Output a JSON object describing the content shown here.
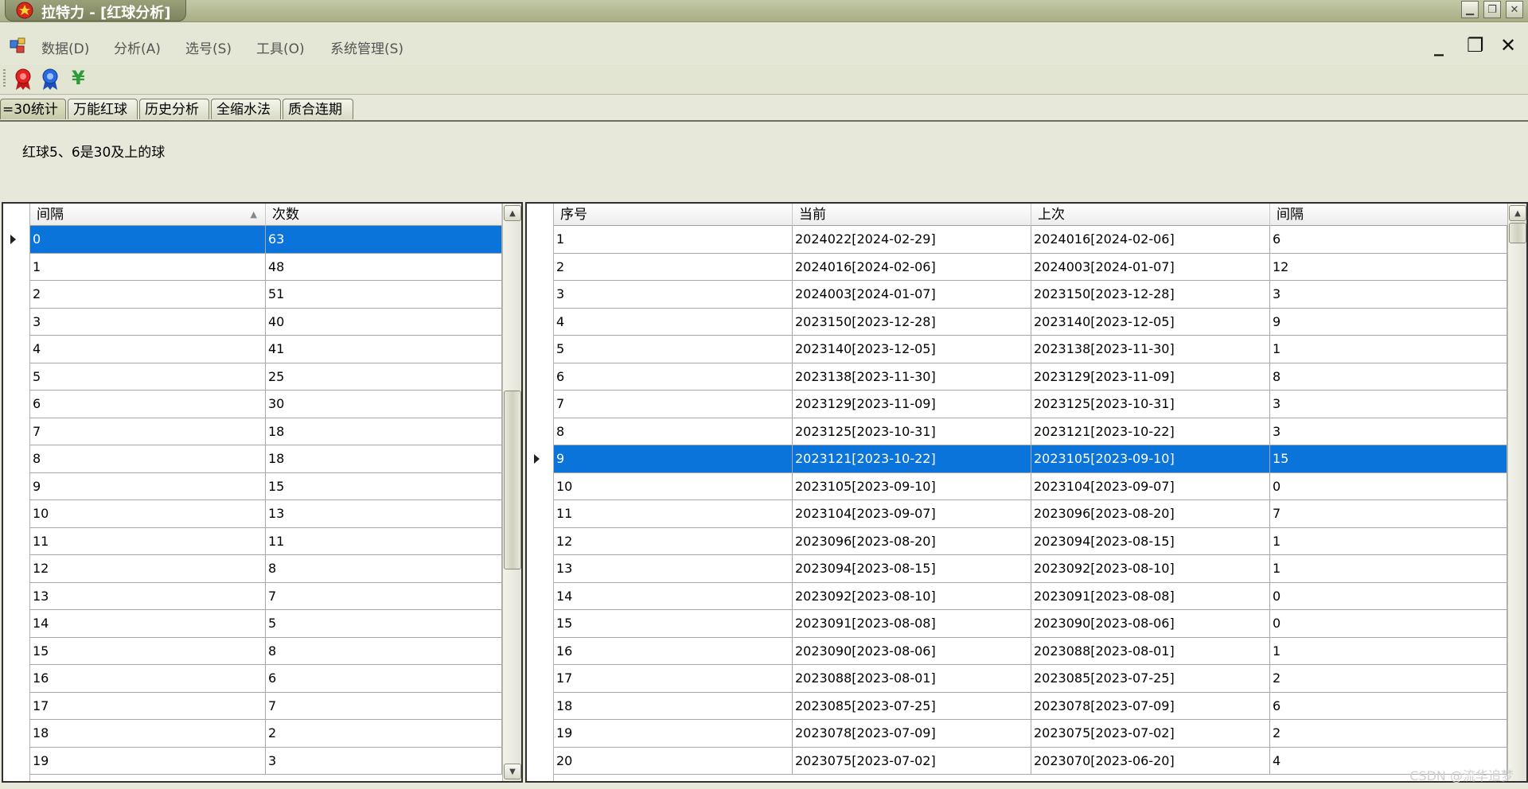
{
  "window": {
    "title": "拉特力 - [红球分析]"
  },
  "menu": {
    "items": [
      "数据(D)",
      "分析(A)",
      "选号(S)",
      "工具(O)",
      "系统管理(S)"
    ]
  },
  "toolbar": {
    "icons": [
      "red-ribbon-icon",
      "blue-ribbon-icon",
      "yen-icon"
    ],
    "yen_glyph": "¥"
  },
  "tabs": [
    "=30统计",
    "万能红球",
    "历史分析",
    "全缩水法",
    "质合连期"
  ],
  "active_tab": 0,
  "info": {
    "text": "红球5、6是30及上的球"
  },
  "left_grid": {
    "columns": [
      "间隔",
      "次数"
    ],
    "selected_row": 0,
    "rows": [
      [
        "0",
        "63"
      ],
      [
        "1",
        "48"
      ],
      [
        "2",
        "51"
      ],
      [
        "3",
        "40"
      ],
      [
        "4",
        "41"
      ],
      [
        "5",
        "25"
      ],
      [
        "6",
        "30"
      ],
      [
        "7",
        "18"
      ],
      [
        "8",
        "18"
      ],
      [
        "9",
        "15"
      ],
      [
        "10",
        "13"
      ],
      [
        "11",
        "11"
      ],
      [
        "12",
        "8"
      ],
      [
        "13",
        "7"
      ],
      [
        "14",
        "5"
      ],
      [
        "15",
        "8"
      ],
      [
        "16",
        "6"
      ],
      [
        "17",
        "7"
      ],
      [
        "18",
        "2"
      ],
      [
        "19",
        "3"
      ]
    ]
  },
  "right_grid": {
    "columns": [
      "序号",
      "当前",
      "上次",
      "间隔"
    ],
    "selected_row": 8,
    "rows": [
      [
        "1",
        "2024022[2024-02-29]",
        "2024016[2024-02-06]",
        "6"
      ],
      [
        "2",
        "2024016[2024-02-06]",
        "2024003[2024-01-07]",
        "12"
      ],
      [
        "3",
        "2024003[2024-01-07]",
        "2023150[2023-12-28]",
        "3"
      ],
      [
        "4",
        "2023150[2023-12-28]",
        "2023140[2023-12-05]",
        "9"
      ],
      [
        "5",
        "2023140[2023-12-05]",
        "2023138[2023-11-30]",
        "1"
      ],
      [
        "6",
        "2023138[2023-11-30]",
        "2023129[2023-11-09]",
        "8"
      ],
      [
        "7",
        "2023129[2023-11-09]",
        "2023125[2023-10-31]",
        "3"
      ],
      [
        "8",
        "2023125[2023-10-31]",
        "2023121[2023-10-22]",
        "3"
      ],
      [
        "9",
        "2023121[2023-10-22]",
        "2023105[2023-09-10]",
        "15"
      ],
      [
        "10",
        "2023105[2023-09-10]",
        "2023104[2023-09-07]",
        "0"
      ],
      [
        "11",
        "2023104[2023-09-07]",
        "2023096[2023-08-20]",
        "7"
      ],
      [
        "12",
        "2023096[2023-08-20]",
        "2023094[2023-08-15]",
        "1"
      ],
      [
        "13",
        "2023094[2023-08-15]",
        "2023092[2023-08-10]",
        "1"
      ],
      [
        "14",
        "2023092[2023-08-10]",
        "2023091[2023-08-08]",
        "0"
      ],
      [
        "15",
        "2023091[2023-08-08]",
        "2023090[2023-08-06]",
        "0"
      ],
      [
        "16",
        "2023090[2023-08-06]",
        "2023088[2023-08-01]",
        "1"
      ],
      [
        "17",
        "2023088[2023-08-01]",
        "2023085[2023-07-25]",
        "2"
      ],
      [
        "18",
        "2023085[2023-07-25]",
        "2023078[2023-07-09]",
        "6"
      ],
      [
        "19",
        "2023078[2023-07-09]",
        "2023075[2023-07-02]",
        "2"
      ],
      [
        "20",
        "2023075[2023-07-02]",
        "2023070[2023-06-20]",
        "4"
      ]
    ]
  },
  "watermark": "CSDN @流华追梦",
  "colors": {
    "selection": "#0a74da",
    "chrome": "#e4e6d6",
    "titlebar": "#a9ae86"
  }
}
